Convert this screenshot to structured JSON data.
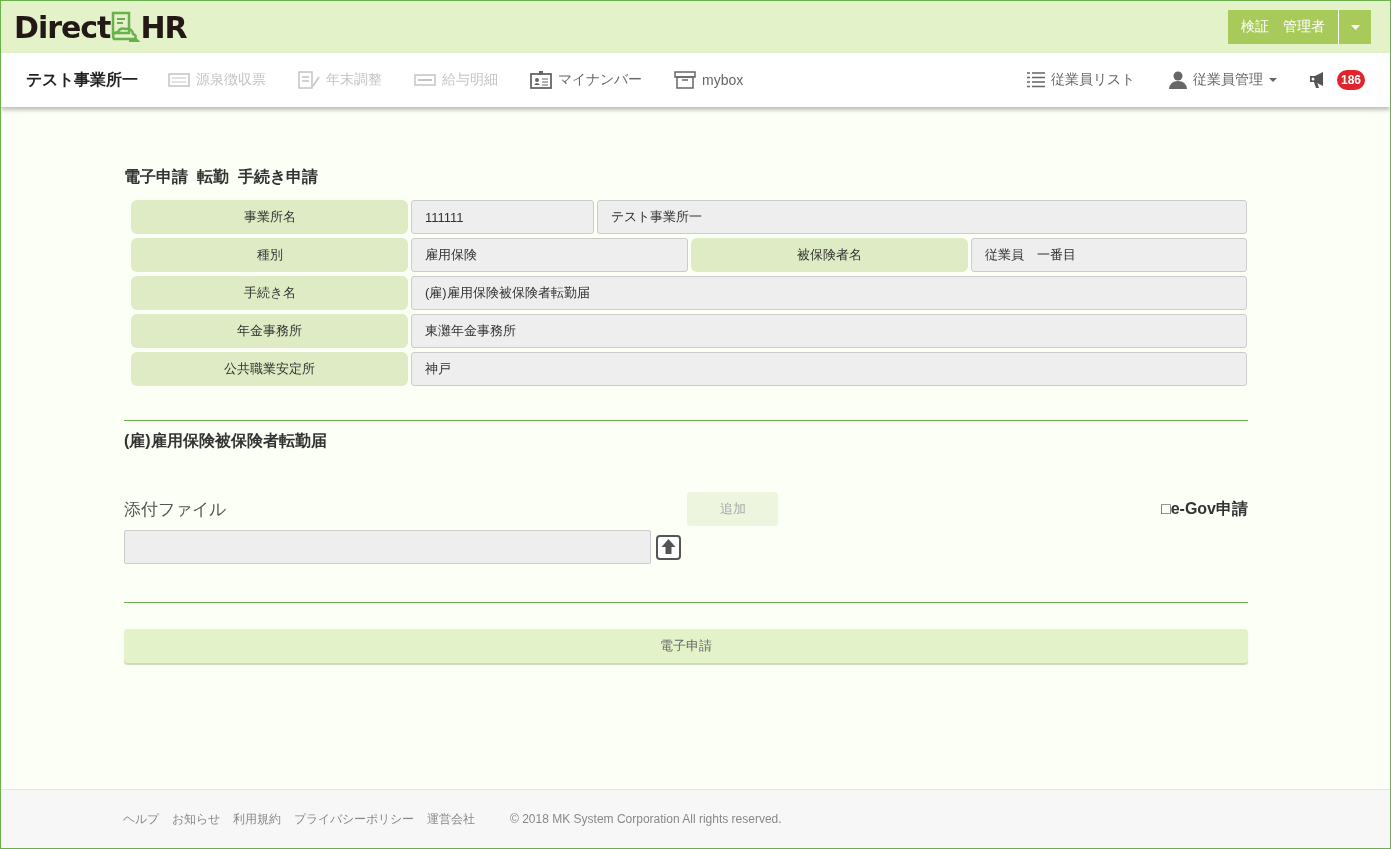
{
  "header": {
    "logo_left": "Direct",
    "logo_right": "HR",
    "user_button": "検証　管理者"
  },
  "nav": {
    "office": "テスト事業所一",
    "items": [
      {
        "label": "源泉徴収票",
        "kind": "slip",
        "disabled": true
      },
      {
        "label": "年末調整",
        "kind": "pen",
        "disabled": true
      },
      {
        "label": "給与明細",
        "kind": "card",
        "disabled": true
      },
      {
        "label": "マイナンバー",
        "kind": "id",
        "disabled": false
      },
      {
        "label": "mybox",
        "kind": "box",
        "disabled": false
      }
    ],
    "right_items": [
      {
        "label": "従業員リスト",
        "kind": "list",
        "dropdown": false
      },
      {
        "label": "従業員管理",
        "kind": "person",
        "dropdown": true
      }
    ],
    "badge": "186"
  },
  "page_title": "電子申請  転勤  手続き申請",
  "info_rows": [
    [
      {
        "kind": "label",
        "text": "事業所名"
      },
      {
        "kind": "code",
        "text": "111111"
      },
      {
        "kind": "value",
        "text": "テスト事業所一"
      }
    ],
    [
      {
        "kind": "label",
        "text": "種別"
      },
      {
        "kind": "value",
        "text": "雇用保険"
      },
      {
        "kind": "label",
        "text": "被保険者名"
      },
      {
        "kind": "value",
        "text": "従業員　一番目"
      }
    ],
    [
      {
        "kind": "label",
        "text": "手続き名"
      },
      {
        "kind": "value",
        "text": "(雇)雇用保険被保険者転勤届"
      }
    ],
    [
      {
        "kind": "label",
        "text": "年金事務所"
      },
      {
        "kind": "value",
        "text": "東灘年金事務所"
      }
    ],
    [
      {
        "kind": "label",
        "text": "公共職業安定所"
      },
      {
        "kind": "value",
        "text": "神戸"
      }
    ]
  ],
  "form_title": "(雇)雇用保険被保険者転勤届",
  "attachment": {
    "label": "添付ファイル",
    "add_button": "追加",
    "add_disabled": true
  },
  "egov": "□e-Gov申請",
  "submit_button": "電子申請",
  "footer": {
    "links": [
      "ヘルプ",
      "お知らせ",
      "利用規約",
      "プライバシーポリシー",
      "運営会社"
    ],
    "copyright": "© 2018 MK System Corporation All rights reserved."
  }
}
